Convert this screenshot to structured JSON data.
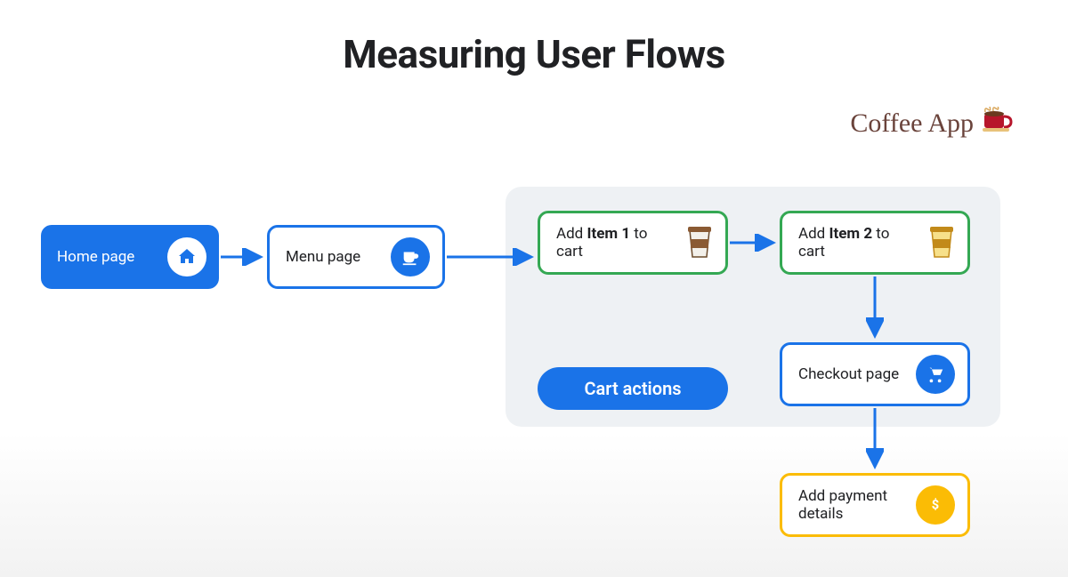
{
  "title": "Measuring User Flows",
  "brand": {
    "name": "Coffee App"
  },
  "group": {
    "label": "Cart actions"
  },
  "nodes": {
    "home": {
      "label": "Home page"
    },
    "menu": {
      "label": "Menu page"
    },
    "add1": {
      "label_pre": "Add ",
      "label_bold": "Item 1",
      "label_post": " to cart"
    },
    "add2": {
      "label_pre": "Add ",
      "label_bold": "Item 2",
      "label_post": " to cart"
    },
    "checkout": {
      "label": "Checkout page"
    },
    "payment": {
      "label": "Add payment details"
    }
  },
  "colors": {
    "blue": "#1a73e8",
    "green": "#34a853",
    "yellow": "#fbbc05",
    "group_bg": "#eef1f4"
  }
}
